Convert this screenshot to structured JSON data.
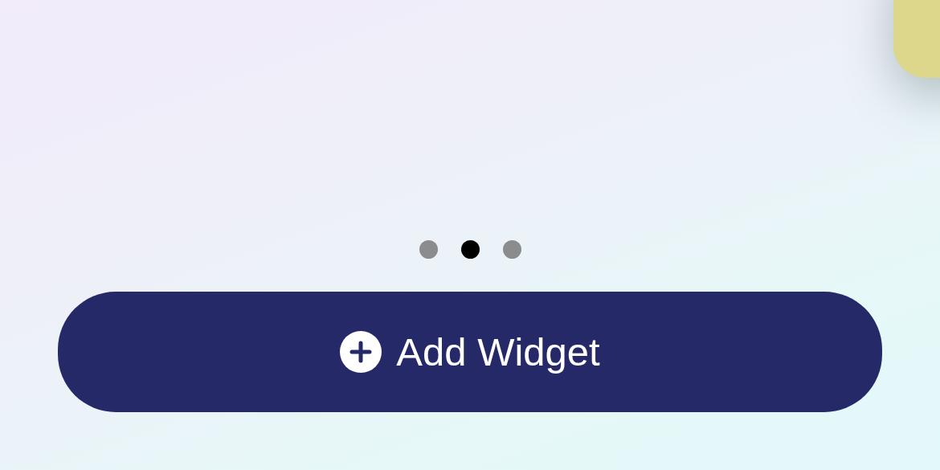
{
  "page_dots": [
    {
      "selected": false
    },
    {
      "selected": true
    },
    {
      "selected": false
    }
  ],
  "add_button": {
    "label": "Add Widget"
  }
}
